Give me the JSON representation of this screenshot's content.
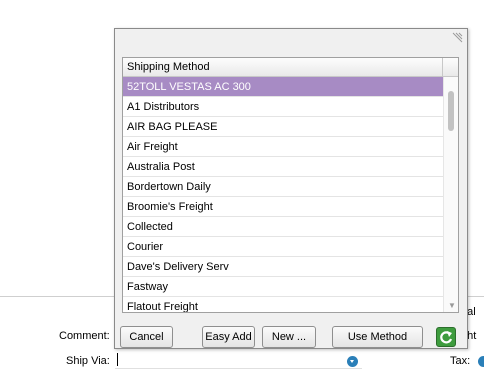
{
  "popup": {
    "list_header": "Shipping Method",
    "rows": [
      "52TOLL VESTAS AC 300",
      "A1 Distributors",
      "AIR BAG PLEASE",
      "Air Freight",
      "Australia Post",
      "Bordertown Daily",
      "Broomie's Freight",
      "Collected",
      "Courier",
      "Dave's Delivery Serv",
      "Fastway",
      "Flatout Freight"
    ],
    "selected_row": "52TOLL VESTAS AC 300",
    "selection_color": "#a78bc4",
    "buttons": {
      "cancel": "Cancel",
      "easy_add": "Easy Add",
      "new": "New ...",
      "use_method": "Use Method",
      "refresh_icon": "refresh-icon"
    }
  },
  "background_form": {
    "comment_label": "Comment:",
    "ship_via_label": "Ship Via:",
    "tax_label": "Tax:",
    "total_partial": "otal",
    "freight_partial": "ght",
    "ship_via_value": ""
  },
  "colors": {
    "accent_blue": "#2a7fb8",
    "refresh_green": "#3e9c3e"
  }
}
